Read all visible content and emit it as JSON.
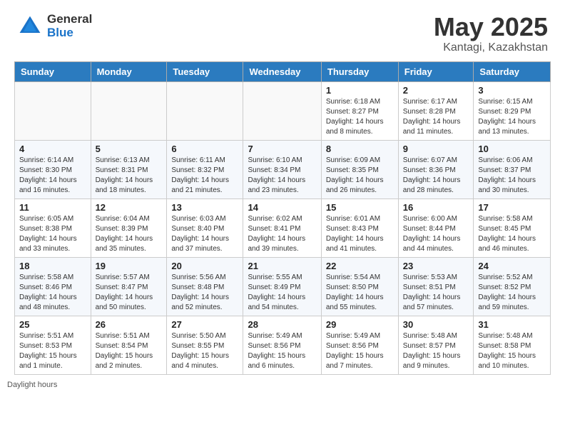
{
  "logo": {
    "general": "General",
    "blue": "Blue"
  },
  "title": "May 2025",
  "location": "Kantagi, Kazakhstan",
  "days_of_week": [
    "Sunday",
    "Monday",
    "Tuesday",
    "Wednesday",
    "Thursday",
    "Friday",
    "Saturday"
  ],
  "footer": "Daylight hours",
  "weeks": [
    [
      {
        "day": "",
        "sunrise": "",
        "sunset": "",
        "daylight": "",
        "empty": true
      },
      {
        "day": "",
        "sunrise": "",
        "sunset": "",
        "daylight": "",
        "empty": true
      },
      {
        "day": "",
        "sunrise": "",
        "sunset": "",
        "daylight": "",
        "empty": true
      },
      {
        "day": "",
        "sunrise": "",
        "sunset": "",
        "daylight": "",
        "empty": true
      },
      {
        "day": "1",
        "sunrise": "6:18 AM",
        "sunset": "8:27 PM",
        "daylight": "14 hours and 8 minutes."
      },
      {
        "day": "2",
        "sunrise": "6:17 AM",
        "sunset": "8:28 PM",
        "daylight": "14 hours and 11 minutes."
      },
      {
        "day": "3",
        "sunrise": "6:15 AM",
        "sunset": "8:29 PM",
        "daylight": "14 hours and 13 minutes."
      }
    ],
    [
      {
        "day": "4",
        "sunrise": "6:14 AM",
        "sunset": "8:30 PM",
        "daylight": "14 hours and 16 minutes."
      },
      {
        "day": "5",
        "sunrise": "6:13 AM",
        "sunset": "8:31 PM",
        "daylight": "14 hours and 18 minutes."
      },
      {
        "day": "6",
        "sunrise": "6:11 AM",
        "sunset": "8:32 PM",
        "daylight": "14 hours and 21 minutes."
      },
      {
        "day": "7",
        "sunrise": "6:10 AM",
        "sunset": "8:34 PM",
        "daylight": "14 hours and 23 minutes."
      },
      {
        "day": "8",
        "sunrise": "6:09 AM",
        "sunset": "8:35 PM",
        "daylight": "14 hours and 26 minutes."
      },
      {
        "day": "9",
        "sunrise": "6:07 AM",
        "sunset": "8:36 PM",
        "daylight": "14 hours and 28 minutes."
      },
      {
        "day": "10",
        "sunrise": "6:06 AM",
        "sunset": "8:37 PM",
        "daylight": "14 hours and 30 minutes."
      }
    ],
    [
      {
        "day": "11",
        "sunrise": "6:05 AM",
        "sunset": "8:38 PM",
        "daylight": "14 hours and 33 minutes."
      },
      {
        "day": "12",
        "sunrise": "6:04 AM",
        "sunset": "8:39 PM",
        "daylight": "14 hours and 35 minutes."
      },
      {
        "day": "13",
        "sunrise": "6:03 AM",
        "sunset": "8:40 PM",
        "daylight": "14 hours and 37 minutes."
      },
      {
        "day": "14",
        "sunrise": "6:02 AM",
        "sunset": "8:41 PM",
        "daylight": "14 hours and 39 minutes."
      },
      {
        "day": "15",
        "sunrise": "6:01 AM",
        "sunset": "8:43 PM",
        "daylight": "14 hours and 41 minutes."
      },
      {
        "day": "16",
        "sunrise": "6:00 AM",
        "sunset": "8:44 PM",
        "daylight": "14 hours and 44 minutes."
      },
      {
        "day": "17",
        "sunrise": "5:58 AM",
        "sunset": "8:45 PM",
        "daylight": "14 hours and 46 minutes."
      }
    ],
    [
      {
        "day": "18",
        "sunrise": "5:58 AM",
        "sunset": "8:46 PM",
        "daylight": "14 hours and 48 minutes."
      },
      {
        "day": "19",
        "sunrise": "5:57 AM",
        "sunset": "8:47 PM",
        "daylight": "14 hours and 50 minutes."
      },
      {
        "day": "20",
        "sunrise": "5:56 AM",
        "sunset": "8:48 PM",
        "daylight": "14 hours and 52 minutes."
      },
      {
        "day": "21",
        "sunrise": "5:55 AM",
        "sunset": "8:49 PM",
        "daylight": "14 hours and 54 minutes."
      },
      {
        "day": "22",
        "sunrise": "5:54 AM",
        "sunset": "8:50 PM",
        "daylight": "14 hours and 55 minutes."
      },
      {
        "day": "23",
        "sunrise": "5:53 AM",
        "sunset": "8:51 PM",
        "daylight": "14 hours and 57 minutes."
      },
      {
        "day": "24",
        "sunrise": "5:52 AM",
        "sunset": "8:52 PM",
        "daylight": "14 hours and 59 minutes."
      }
    ],
    [
      {
        "day": "25",
        "sunrise": "5:51 AM",
        "sunset": "8:53 PM",
        "daylight": "15 hours and 1 minute."
      },
      {
        "day": "26",
        "sunrise": "5:51 AM",
        "sunset": "8:54 PM",
        "daylight": "15 hours and 2 minutes."
      },
      {
        "day": "27",
        "sunrise": "5:50 AM",
        "sunset": "8:55 PM",
        "daylight": "15 hours and 4 minutes."
      },
      {
        "day": "28",
        "sunrise": "5:49 AM",
        "sunset": "8:56 PM",
        "daylight": "15 hours and 6 minutes."
      },
      {
        "day": "29",
        "sunrise": "5:49 AM",
        "sunset": "8:56 PM",
        "daylight": "15 hours and 7 minutes."
      },
      {
        "day": "30",
        "sunrise": "5:48 AM",
        "sunset": "8:57 PM",
        "daylight": "15 hours and 9 minutes."
      },
      {
        "day": "31",
        "sunrise": "5:48 AM",
        "sunset": "8:58 PM",
        "daylight": "15 hours and 10 minutes."
      }
    ]
  ]
}
